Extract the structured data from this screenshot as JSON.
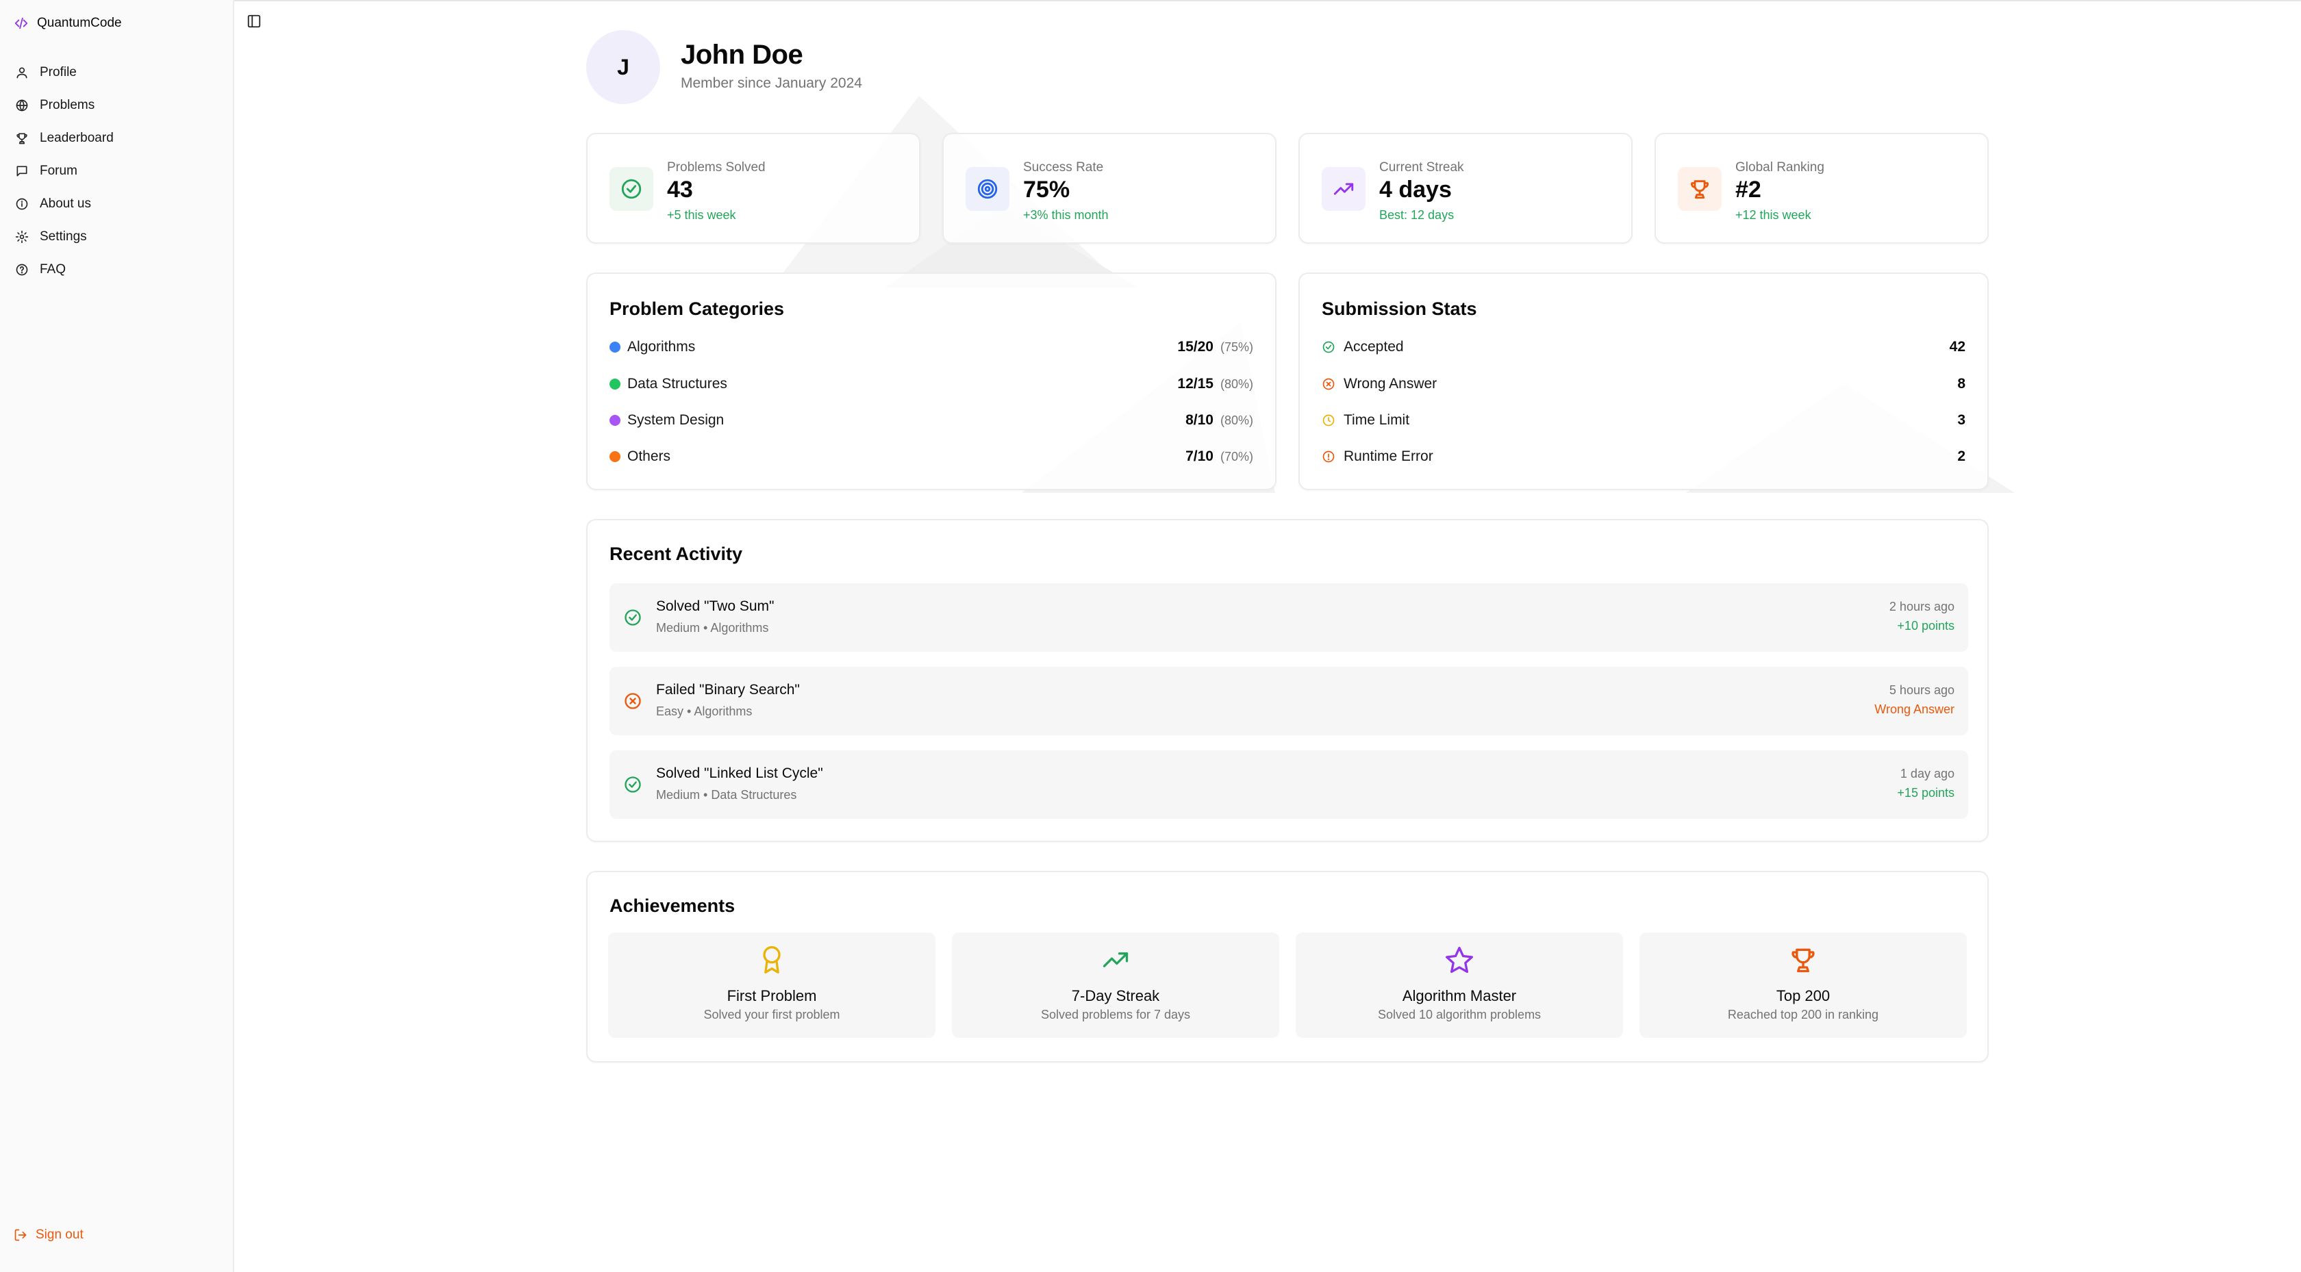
{
  "app": {
    "brand": "QuantumCode"
  },
  "sidebar": {
    "items": [
      {
        "label": "Profile",
        "icon": "user-icon"
      },
      {
        "label": "Problems",
        "icon": "globe-icon"
      },
      {
        "label": "Leaderboard",
        "icon": "trophy-icon"
      },
      {
        "label": "Forum",
        "icon": "message-icon"
      },
      {
        "label": "About us",
        "icon": "info-icon"
      },
      {
        "label": "Settings",
        "icon": "gear-icon"
      },
      {
        "label": "FAQ",
        "icon": "help-icon"
      }
    ],
    "signout": "Sign out"
  },
  "profile": {
    "initial": "J",
    "name": "John Doe",
    "member_since": "Member since January 2024"
  },
  "stats": [
    {
      "label": "Problems Solved",
      "value": "43",
      "sub": "+5 this week",
      "icon": "check-circle-icon",
      "color": "#22a55b",
      "bg": "#eef6f0"
    },
    {
      "label": "Success Rate",
      "value": "75%",
      "sub": "+3% this month",
      "icon": "target-icon",
      "color": "#2563eb",
      "bg": "#eef1fb"
    },
    {
      "label": "Current Streak",
      "value": "4 days",
      "sub": "Best: 12 days",
      "icon": "trending-up-icon",
      "color": "#9333ea",
      "bg": "#f4effc"
    },
    {
      "label": "Global Ranking",
      "value": "#2",
      "sub": "+12 this week",
      "icon": "trophy-icon",
      "color": "#ea580c",
      "bg": "#fdf1ea"
    }
  ],
  "categories": {
    "title": "Problem Categories",
    "items": [
      {
        "label": "Algorithms",
        "count": "15/20",
        "pct": "(75%)",
        "color": "#3b82f6"
      },
      {
        "label": "Data Structures",
        "count": "12/15",
        "pct": "(80%)",
        "color": "#22c55e"
      },
      {
        "label": "System Design",
        "count": "8/10",
        "pct": "(80%)",
        "color": "#a855f7"
      },
      {
        "label": "Others",
        "count": "7/10",
        "pct": "(70%)",
        "color": "#f97316"
      }
    ]
  },
  "submissions": {
    "title": "Submission Stats",
    "items": [
      {
        "label": "Accepted",
        "count": "42",
        "icon": "check-circle-icon",
        "color": "#22a55b"
      },
      {
        "label": "Wrong Answer",
        "count": "8",
        "icon": "x-circle-icon",
        "color": "#ea580c"
      },
      {
        "label": "Time Limit",
        "count": "3",
        "icon": "clock-icon",
        "color": "#eab308"
      },
      {
        "label": "Runtime Error",
        "count": "2",
        "icon": "alert-circle-icon",
        "color": "#ea580c"
      }
    ]
  },
  "activity": {
    "title": "Recent Activity",
    "items": [
      {
        "title": "Solved \"Two Sum\"",
        "meta": "Medium • Algorithms",
        "time": "2 hours ago",
        "result": "+10 points",
        "status": "success",
        "color": "#22a55b"
      },
      {
        "title": "Failed \"Binary Search\"",
        "meta": "Easy • Algorithms",
        "time": "5 hours ago",
        "result": "Wrong Answer",
        "status": "fail",
        "color": "#ea580c"
      },
      {
        "title": "Solved \"Linked List Cycle\"",
        "meta": "Medium • Data Structures",
        "time": "1 day ago",
        "result": "+15 points",
        "status": "success",
        "color": "#22a55b"
      }
    ]
  },
  "achievements": {
    "title": "Achievements",
    "items": [
      {
        "title": "First Problem",
        "desc": "Solved your first problem",
        "icon": "award-icon",
        "color": "#eab308"
      },
      {
        "title": "7-Day Streak",
        "desc": "Solved problems for 7 days",
        "icon": "trending-up-icon",
        "color": "#22a55b"
      },
      {
        "title": "Algorithm Master",
        "desc": "Solved 10 algorithm problems",
        "icon": "star-icon",
        "color": "#9333ea"
      },
      {
        "title": "Top 200",
        "desc": "Reached top 200 in ranking",
        "icon": "trophy-icon",
        "color": "#ea580c"
      }
    ]
  }
}
